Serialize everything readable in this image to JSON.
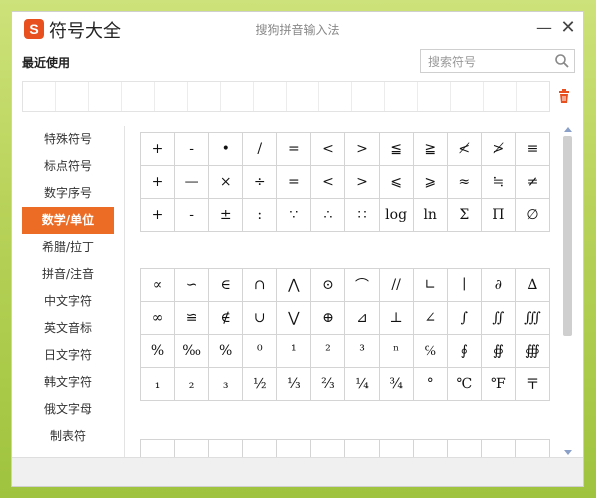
{
  "window": {
    "app_title": "符号大全",
    "subtitle": "搜狗拼音输入法",
    "logo_text": "S",
    "minimize_label": "—",
    "close_label": "✕"
  },
  "recent": {
    "label": "最近使用",
    "cell_count": 16
  },
  "search": {
    "placeholder": "搜索符号",
    "value": ""
  },
  "sidebar": {
    "items": [
      {
        "label": "特殊符号"
      },
      {
        "label": "标点符号"
      },
      {
        "label": "数字序号"
      },
      {
        "label": "数学/单位",
        "active": true
      },
      {
        "label": "希腊/拉丁"
      },
      {
        "label": "拼音/注音"
      },
      {
        "label": "中文字符"
      },
      {
        "label": "英文音标"
      },
      {
        "label": "日文字符"
      },
      {
        "label": "韩文字符"
      },
      {
        "label": "俄文字母"
      },
      {
        "label": "制表符"
      }
    ]
  },
  "grid1": [
    "+",
    "-",
    "•",
    "/",
    "=",
    "<",
    ">",
    "≦",
    "≧",
    "≮",
    "≯",
    "≡",
    "+",
    "—",
    "×",
    "÷",
    "=",
    "<",
    ">",
    "⩽",
    "⩾",
    "≈",
    "≒",
    "≠",
    "+",
    "-",
    "±",
    ":",
    "∵",
    "∴",
    "∷",
    "log",
    "ln",
    "Σ",
    "Π",
    "∅"
  ],
  "grid2": [
    "∝",
    "∽",
    "∈",
    "∩",
    "⋀",
    "⊙",
    "⌒",
    "//",
    "∟",
    "∣",
    "∂",
    "∆",
    "∞",
    "≌",
    "∉",
    "∪",
    "⋁",
    "⊕",
    "⊿",
    "⊥",
    "∠",
    "∫",
    "∬",
    "∭",
    "%",
    "‰",
    "%",
    "⁰",
    "¹",
    "²",
    "³",
    "ⁿ",
    "℅",
    "∮",
    "∯",
    "∰",
    "₁",
    "₂",
    "₃",
    "½",
    "⅓",
    "⅔",
    "¼",
    "¾",
    "°",
    "℃",
    "℉",
    "〒"
  ],
  "grid3": [
    "",
    "",
    "",
    "",
    "",
    "",
    "",
    "",
    "",
    "",
    "",
    ""
  ],
  "colors": {
    "accent": "#ec6c25",
    "logo": "#e8511f",
    "trash": "#e8511f"
  },
  "icons": {
    "search": "search-icon",
    "trash": "trash-icon"
  }
}
